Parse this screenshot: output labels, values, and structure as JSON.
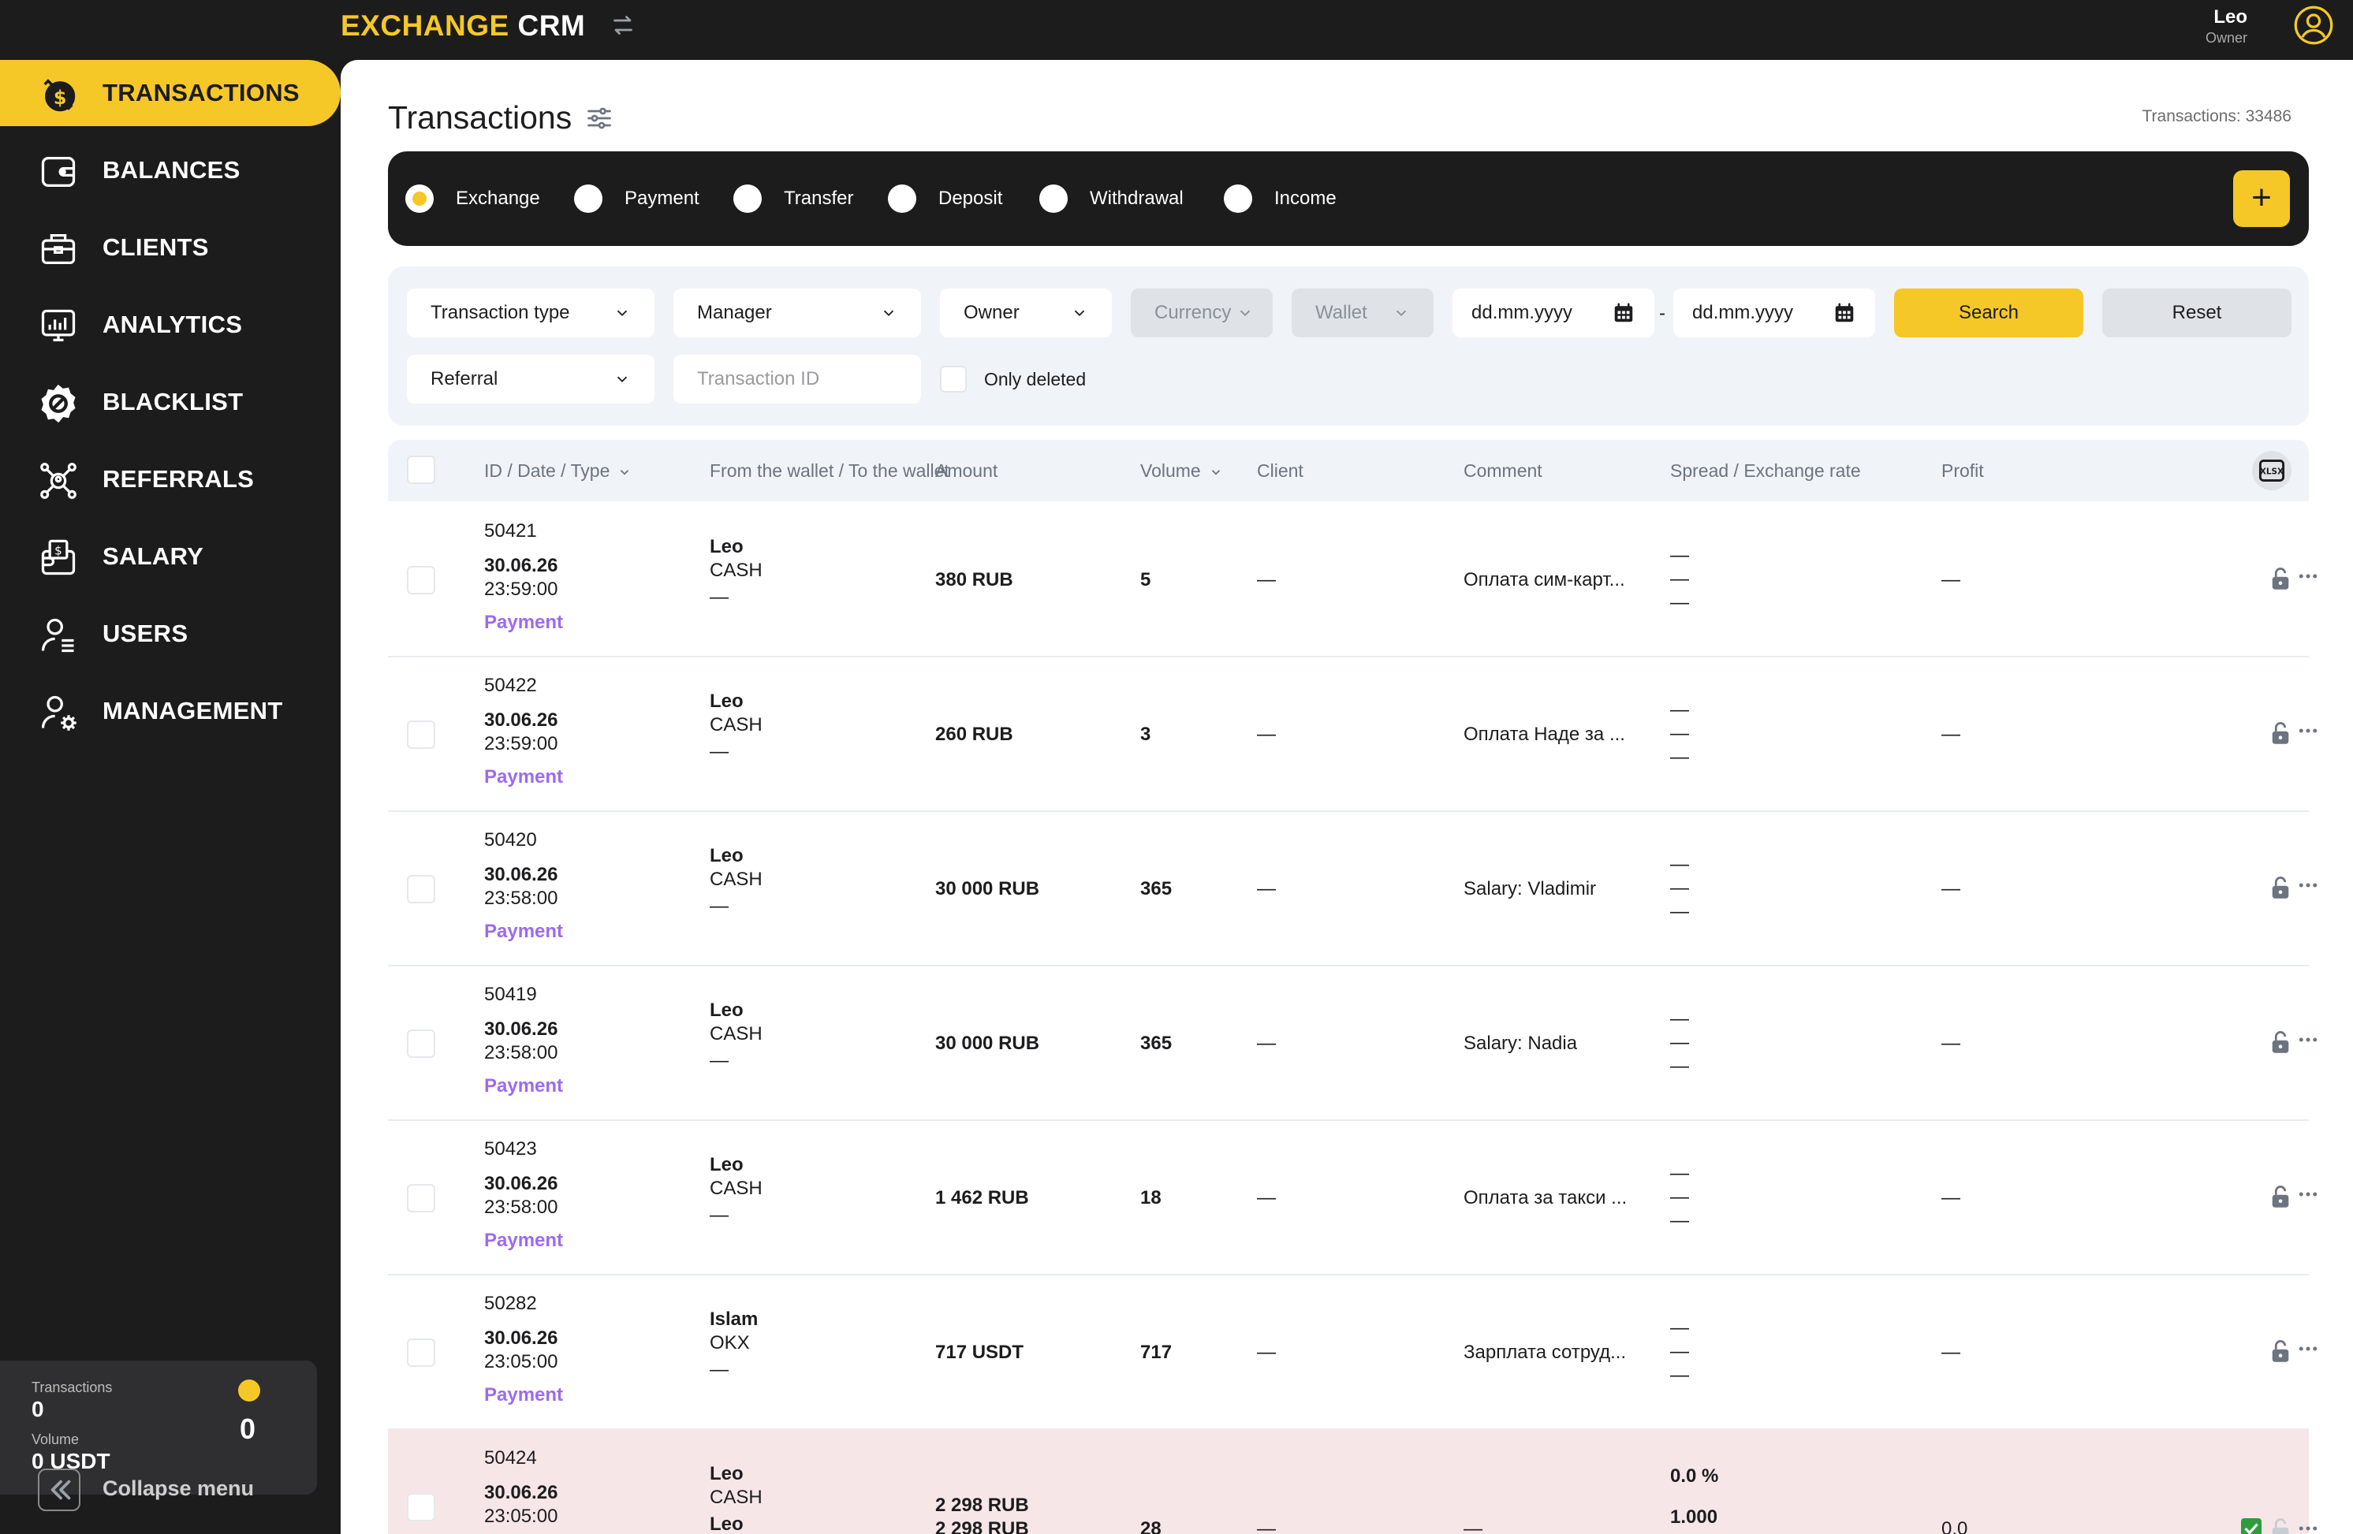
{
  "app": {
    "logo_a": "EXCHANGE",
    "logo_b": "CRM"
  },
  "user": {
    "name": "Leo",
    "role": "Owner"
  },
  "sidebar": {
    "items": [
      {
        "label": "TRANSACTIONS",
        "icon": "dollar-coin-icon",
        "active": true
      },
      {
        "label": "BALANCES",
        "icon": "wallet-icon"
      },
      {
        "label": "CLIENTS",
        "icon": "briefcase-icon"
      },
      {
        "label": "ANALYTICS",
        "icon": "chart-icon"
      },
      {
        "label": "BLACKLIST",
        "icon": "blocked-badge-icon"
      },
      {
        "label": "REFERRALS",
        "icon": "network-icon"
      },
      {
        "label": "SALARY",
        "icon": "salary-icon"
      },
      {
        "label": "USERS",
        "icon": "user-list-icon"
      },
      {
        "label": "MANAGEMENT",
        "icon": "user-gear-icon"
      }
    ],
    "stats": {
      "transactions_label": "Transactions",
      "transactions_value": "0",
      "volume_label": "Volume",
      "volume_value": "0 USDT",
      "badge_value": "0"
    },
    "collapse_label": "Collapse menu"
  },
  "page": {
    "title": "Transactions",
    "count_text": "Transactions: 33486"
  },
  "types": [
    {
      "label": "Exchange",
      "selected": true
    },
    {
      "label": "Payment"
    },
    {
      "label": "Transfer"
    },
    {
      "label": "Deposit"
    },
    {
      "label": "Withdrawal"
    },
    {
      "label": "Income"
    }
  ],
  "add_label": "+",
  "filters": {
    "transaction_type": "Transaction type",
    "manager": "Manager",
    "owner": "Owner",
    "currency": "Currency",
    "wallet": "Wallet",
    "date_from": "dd.mm.yyyy",
    "date_sep": "-",
    "date_to": "dd.mm.yyyy",
    "search": "Search",
    "reset": "Reset",
    "referral": "Referral",
    "transaction_id_placeholder": "Transaction ID",
    "only_deleted": "Only deleted"
  },
  "table": {
    "columns": [
      "ID / Date / Type",
      "From the wallet / To the wallet",
      "Amount",
      "Volume",
      "Client",
      "Comment",
      "Spread / Exchange rate",
      "Profit"
    ],
    "rows": [
      {
        "id": "50421",
        "date": "30.06.26",
        "time": "23:59:00",
        "type": "Payment",
        "wallet_name": "Leo",
        "wallet_account": "CASH",
        "wallet_to": "—",
        "amount": "380 RUB",
        "volume": "5",
        "client": "—",
        "comment": "Оплата сим-карт...",
        "spread": "—\n—\n—",
        "profit": "—"
      },
      {
        "id": "50422",
        "date": "30.06.26",
        "time": "23:59:00",
        "type": "Payment",
        "wallet_name": "Leo",
        "wallet_account": "CASH",
        "wallet_to": "—",
        "amount": "260 RUB",
        "volume": "3",
        "client": "—",
        "comment": "Оплата Наде за ...",
        "spread": "—\n—\n—",
        "profit": "—"
      },
      {
        "id": "50420",
        "date": "30.06.26",
        "time": "23:58:00",
        "type": "Payment",
        "wallet_name": "Leo",
        "wallet_account": "CASH",
        "wallet_to": "—",
        "amount": "30 000 RUB",
        "volume": "365",
        "client": "—",
        "comment": "Salary: Vladimir",
        "spread": "—\n—\n—",
        "profit": "—"
      },
      {
        "id": "50419",
        "date": "30.06.26",
        "time": "23:58:00",
        "type": "Payment",
        "wallet_name": "Leo",
        "wallet_account": "CASH",
        "wallet_to": "—",
        "amount": "30 000 RUB",
        "volume": "365",
        "client": "—",
        "comment": "Salary: Nadia",
        "spread": "—\n—\n—",
        "profit": "—"
      },
      {
        "id": "50423",
        "date": "30.06.26",
        "time": "23:58:00",
        "type": "Payment",
        "wallet_name": "Leo",
        "wallet_account": "CASH",
        "wallet_to": "—",
        "amount": "1 462 RUB",
        "volume": "18",
        "client": "—",
        "comment": "Оплата за такси ...",
        "spread": "—\n—\n—",
        "profit": "—"
      },
      {
        "id": "50282",
        "date": "30.06.26",
        "time": "23:05:00",
        "type": "Payment",
        "wallet_name": "Islam",
        "wallet_account": "OKX",
        "wallet_to": "—",
        "amount": "717 USDT",
        "volume": "717",
        "client": "—",
        "comment": "Зарплата сотруд...",
        "spread": "—\n—\n—",
        "profit": "—"
      },
      {
        "id": "50424",
        "date": "30.06.26",
        "time": "23:05:00",
        "type": "",
        "wallet_name": "Leo",
        "wallet_account": "CASH",
        "wallet_to": "Leo",
        "amount": "2 298 RUB",
        "amount2": "2 298 RUB",
        "volume": "28",
        "client": "—",
        "comment": "—",
        "spread_a": "0.0 %",
        "spread_b": "1.000",
        "profit": "0.0"
      }
    ]
  },
  "colors": {
    "accent": "#f5c828",
    "dark": "#1c1c1c",
    "type_purple": "#9b6bf0",
    "highlight_row": "#f7e6e8"
  }
}
